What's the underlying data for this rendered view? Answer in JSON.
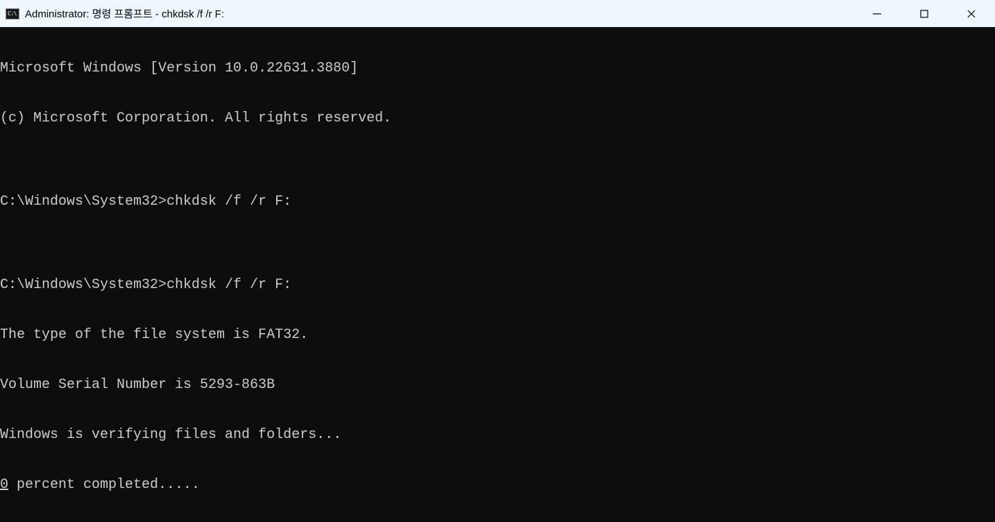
{
  "titlebar": {
    "icon_text": "C:\\",
    "title": "Administrator: 명령 프롬프트 - chkdsk  /f /r F:"
  },
  "terminal": {
    "lines": [
      "Microsoft Windows [Version 10.0.22631.3880]",
      "(c) Microsoft Corporation. All rights reserved.",
      "",
      "C:\\Windows\\System32>chkdsk /f /r F:",
      "",
      "C:\\Windows\\System32>chkdsk /f /r F:",
      "The type of the file system is FAT32.",
      "Volume Serial Number is 5293-863B",
      "Windows is verifying files and folders..."
    ],
    "progress_percent": "0",
    "progress_text": " percent completed....."
  }
}
